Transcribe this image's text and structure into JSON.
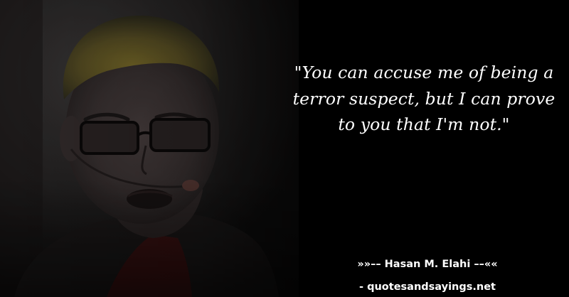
{
  "quote": {
    "text": "\"You can accuse me of being a terror suspect, but I can prove to you that I'm not.\""
  },
  "attribution": {
    "author_line": "»»–– Hasan M. Elahi ––««",
    "source": "- quotesandsayings.net"
  },
  "colors": {
    "background": "#000000",
    "text": "#ffffff",
    "photo_tone": "#3a3535",
    "hair_tint": "#8a7a2a",
    "accent_red": "#5a1414"
  }
}
